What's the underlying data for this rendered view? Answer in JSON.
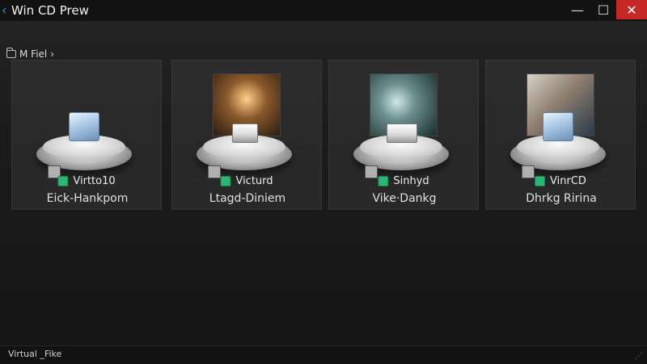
{
  "window": {
    "title": "Win CD Prew",
    "controls": {
      "minimize": "—",
      "maximize": "☐",
      "close": "✕"
    }
  },
  "breadcrumb": {
    "label": "M Fiel",
    "chevron": "›"
  },
  "tiles": [
    {
      "name": "Virtto10",
      "subtitle": "Eick-Hankpom",
      "image": "none"
    },
    {
      "name": "Victurd",
      "subtitle": "Ltagd-Diniem",
      "image": "reel-person"
    },
    {
      "name": "Sinhyd",
      "subtitle": "Vike·Dankg",
      "image": "film-reel"
    },
    {
      "name": "VinrCD",
      "subtitle": "Dhrkg Ririna",
      "image": "people-photo"
    }
  ],
  "statusbar": {
    "text": "Virtual _Fike"
  },
  "colors": {
    "accent": "#3c8bd9",
    "close": "#c62828",
    "badge": "#2bb673"
  }
}
